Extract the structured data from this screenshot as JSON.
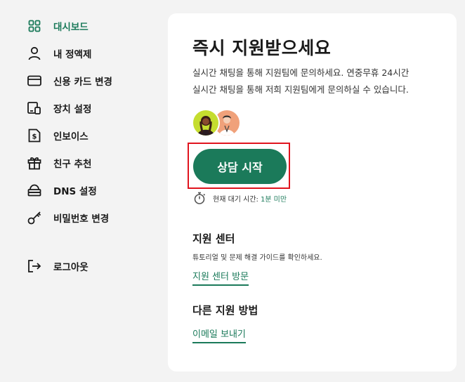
{
  "sidebar": {
    "items": [
      {
        "label": "대시보드",
        "icon": "grid-icon",
        "active": true
      },
      {
        "label": "내 정액제",
        "icon": "user-icon"
      },
      {
        "label": "신용 카드 변경",
        "icon": "credit-card-icon"
      },
      {
        "label": "장치 설정",
        "icon": "devices-icon"
      },
      {
        "label": "인보이스",
        "icon": "invoice-icon"
      },
      {
        "label": "친구 추천",
        "icon": "gift-icon"
      },
      {
        "label": "DNS 설정",
        "icon": "dns-icon"
      },
      {
        "label": "비밀번호 변경",
        "icon": "key-icon"
      }
    ],
    "logout_label": "로그아웃",
    "logout_icon": "logout-icon"
  },
  "support": {
    "title": "즉시 지원받으세요",
    "description_line1": "실시간 채팅을 통해 지원팀에 문의하세요. 연중무휴 24시간",
    "description_line2": "실시간 채팅을 통해 저희 지원팀에게 문의하실 수 있습니다.",
    "chat_button_label": "상담 시작",
    "wait_label": "현재 대기 시간:",
    "wait_value": "1분 미만"
  },
  "help_center": {
    "title": "지원 센터",
    "description": "튜토리얼 및 문제 해결 가이드를 확인하세요.",
    "link_label": "지원 센터 방문"
  },
  "other_support": {
    "title": "다른 지원 방법",
    "link_label": "이메일 보내기"
  },
  "colors": {
    "accent": "#1b7a5a",
    "highlight": "#e0141e",
    "background": "#f3f3f3",
    "card": "#ffffff"
  }
}
